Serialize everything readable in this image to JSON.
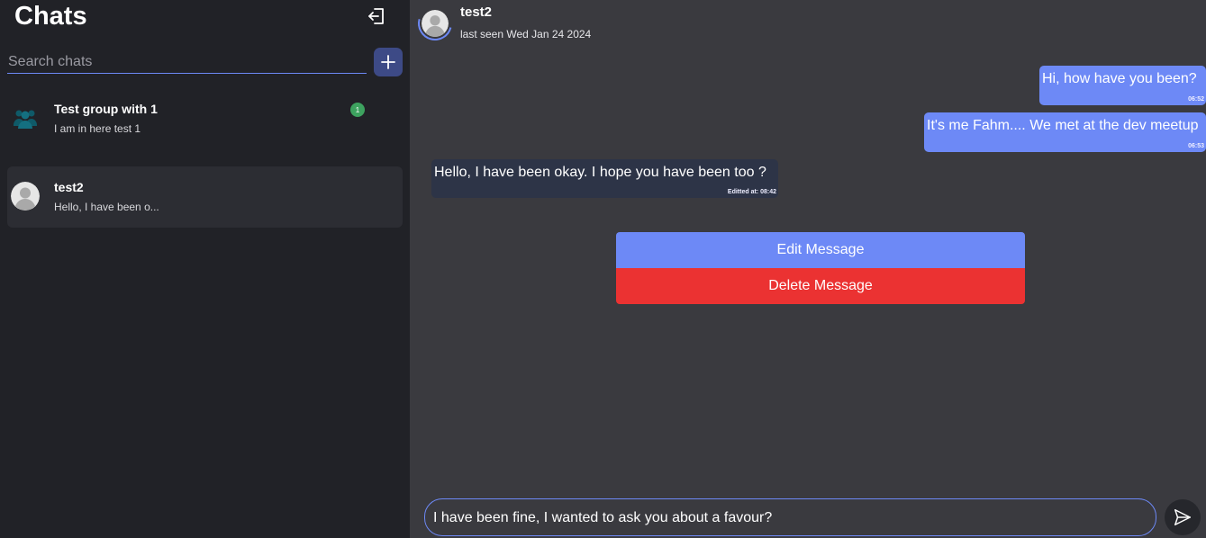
{
  "sidebar": {
    "title": "Chats",
    "search_placeholder": "Search chats",
    "chats": [
      {
        "name": "Test group with 1",
        "preview": "I am in here test 1",
        "unread": "1",
        "icon": "group-avatar-icon"
      },
      {
        "name": "test2",
        "preview": "Hello, I have been o...",
        "icon": "user-avatar-icon"
      }
    ]
  },
  "header": {
    "name": "test2",
    "status": "last seen Wed Jan 24 2024",
    "icon": "user-avatar-icon"
  },
  "messages": [
    {
      "text": "Hi, how have you been?",
      "time": "06:52",
      "direction": "out"
    },
    {
      "text": "It's me Fahm.... We met at the dev meetup",
      "time": "06:53",
      "direction": "out"
    },
    {
      "text": "Hello, I have been okay. I hope you have been too ?",
      "time": "Editted at: 08:42",
      "direction": "in"
    }
  ],
  "action_menu": {
    "edit_label": "Edit Message",
    "delete_label": "Delete Message"
  },
  "composer": {
    "value": "I have been fine, I wanted to ask you about a favour?"
  },
  "icons": {
    "logout": "logout-icon",
    "new_chat": "plus-icon",
    "send": "send-icon"
  },
  "colors": {
    "accent": "#6d89f6",
    "danger": "#eb3232",
    "sidebar_bg": "#212227",
    "chat_bg": "#3a3a3f",
    "badge": "#3da25f"
  }
}
